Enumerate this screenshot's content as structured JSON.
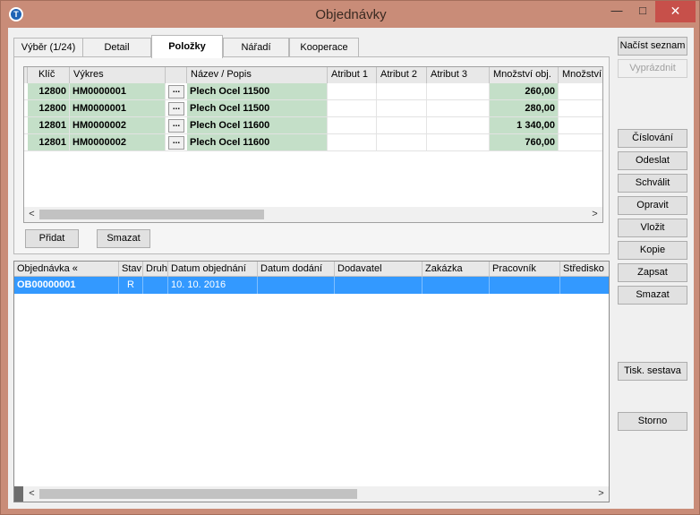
{
  "window": {
    "title": "Objednávky",
    "min_glyph": "—",
    "max_glyph": "□",
    "close_glyph": "✕",
    "app_icon_letter": "T"
  },
  "tabs": [
    {
      "label": "Výběr (1/24)"
    },
    {
      "label": "Detail"
    },
    {
      "label": "Položky"
    },
    {
      "label": "Nářadí"
    },
    {
      "label": "Kooperace"
    }
  ],
  "items_grid": {
    "columns": [
      "Klíč",
      "Výkres",
      "",
      "Název / Popis",
      "Atribut 1",
      "Atribut 2",
      "Atribut 3",
      "Množství obj.",
      "Množství"
    ],
    "rows": [
      {
        "key": "12800",
        "drawing": "HM0000001",
        "button": "...",
        "name": "Plech Ocel 11500",
        "attr1": "",
        "attr2": "",
        "attr3": "",
        "qty": "260,00"
      },
      {
        "key": "12800",
        "drawing": "HM0000001",
        "button": "...",
        "name": "Plech Ocel 11500",
        "attr1": "",
        "attr2": "",
        "attr3": "",
        "qty": "280,00"
      },
      {
        "key": "12801",
        "drawing": "HM0000002",
        "button": "...",
        "name": "Plech Ocel 11600",
        "attr1": "",
        "attr2": "",
        "attr3": "",
        "qty": "1 340,00"
      },
      {
        "key": "12801",
        "drawing": "HM0000002",
        "button": "...",
        "name": "Plech Ocel 11600",
        "attr1": "",
        "attr2": "",
        "attr3": "",
        "qty": "760,00"
      }
    ]
  },
  "panel_buttons": {
    "add": "Přidat",
    "delete": "Smazat"
  },
  "orders_grid": {
    "columns": [
      "Objednávka «",
      "Stav",
      "Druh",
      "Datum objednání",
      "Datum dodání",
      "Dodavatel",
      "Zakázka",
      "Pracovník",
      "Středisko"
    ],
    "rows": [
      {
        "order": "OB00000001",
        "status": "R",
        "type": "",
        "order_date": "10. 10. 2016",
        "delivery_date": "",
        "supplier": "",
        "job": "",
        "worker": "",
        "center": ""
      }
    ]
  },
  "side_buttons": {
    "load_list": "Načíst seznam",
    "clear": "Vyprázdnit",
    "numbering": "Číslování",
    "send": "Odeslat",
    "approve": "Schválit",
    "fix": "Opravit",
    "insert": "Vložit",
    "copy": "Kopie",
    "write": "Zapsat",
    "delete": "Smazat",
    "print_report": "Tisk. sestava",
    "cancel": "Storno"
  },
  "scroll": {
    "left_glyph": "<",
    "right_glyph": ">"
  }
}
